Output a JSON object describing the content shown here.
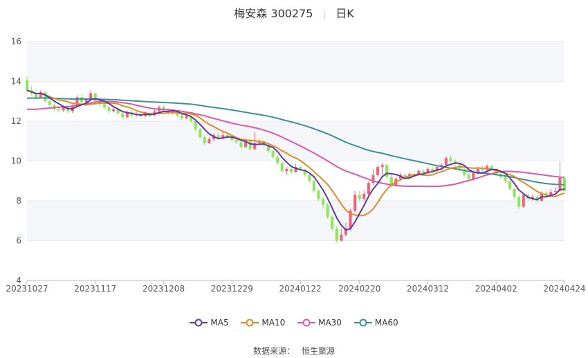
{
  "title": {
    "name": "梅安森 300275",
    "period": "日K"
  },
  "source": {
    "label": "数据来源：",
    "name": "恒生聚源"
  },
  "colors": {
    "up": "#f0637a",
    "down": "#8fe65a",
    "MA5": "#5d3a9b",
    "MA10": "#e08a2a",
    "MA30": "#d95aa8",
    "MA60": "#3a9196",
    "grid": "#e6e9f0",
    "band": "#f5f6fa"
  },
  "chart_data": {
    "type": "candlestick",
    "ylim": [
      4,
      16
    ],
    "yticks": [
      4,
      6,
      8,
      10,
      12,
      14,
      16
    ],
    "xticks": [
      "20231027",
      "20231117",
      "20231208",
      "20231229",
      "20240122",
      "20240220",
      "20240312",
      "20240402",
      "20240424"
    ],
    "xtick_index": [
      0,
      15,
      30,
      45,
      60,
      73,
      88,
      103,
      118
    ],
    "n": 119,
    "legend": [
      "MA5",
      "MA10",
      "MA30",
      "MA60"
    ],
    "ohlc": [
      [
        14.05,
        13.55,
        14.25,
        13.45
      ],
      [
        13.55,
        13.4,
        13.75,
        13.3
      ],
      [
        13.4,
        13.2,
        13.5,
        13.1
      ],
      [
        13.2,
        13.45,
        13.55,
        13.15
      ],
      [
        13.45,
        13.0,
        13.5,
        12.95
      ],
      [
        13.0,
        12.8,
        13.1,
        12.7
      ],
      [
        12.8,
        12.6,
        12.9,
        12.5
      ],
      [
        12.6,
        12.55,
        12.75,
        12.45
      ],
      [
        12.55,
        12.7,
        12.8,
        12.45
      ],
      [
        12.7,
        12.5,
        12.75,
        12.4
      ],
      [
        12.5,
        12.75,
        12.85,
        12.4
      ],
      [
        12.75,
        13.2,
        13.3,
        12.7
      ],
      [
        13.2,
        12.95,
        13.35,
        12.85
      ],
      [
        12.95,
        13.1,
        13.2,
        12.9
      ],
      [
        13.1,
        13.4,
        13.55,
        13.0
      ],
      [
        13.4,
        13.0,
        13.45,
        12.9
      ],
      [
        13.0,
        12.85,
        13.1,
        12.75
      ],
      [
        12.85,
        12.7,
        12.95,
        12.6
      ],
      [
        12.7,
        12.5,
        12.8,
        12.4
      ],
      [
        12.5,
        12.6,
        12.7,
        12.45
      ],
      [
        12.6,
        12.4,
        12.7,
        12.3
      ],
      [
        12.4,
        12.2,
        12.5,
        12.1
      ],
      [
        12.2,
        12.45,
        12.55,
        12.15
      ],
      [
        12.45,
        12.3,
        12.55,
        12.2
      ],
      [
        12.3,
        12.35,
        12.45,
        12.2
      ],
      [
        12.35,
        12.25,
        12.45,
        12.15
      ],
      [
        12.25,
        12.4,
        12.5,
        12.2
      ],
      [
        12.4,
        12.3,
        12.5,
        12.2
      ],
      [
        12.3,
        12.5,
        12.6,
        12.25
      ],
      [
        12.5,
        12.7,
        12.8,
        12.4
      ],
      [
        12.7,
        12.55,
        12.8,
        12.45
      ],
      [
        12.55,
        12.4,
        12.65,
        12.3
      ],
      [
        12.4,
        12.5,
        12.6,
        12.35
      ],
      [
        12.5,
        12.3,
        12.55,
        12.2
      ],
      [
        12.3,
        12.15,
        12.4,
        12.05
      ],
      [
        12.15,
        12.25,
        12.35,
        12.1
      ],
      [
        12.25,
        12.0,
        12.3,
        11.9
      ],
      [
        12.0,
        11.6,
        12.05,
        11.5
      ],
      [
        11.6,
        11.2,
        11.65,
        11.1
      ],
      [
        11.2,
        10.9,
        11.3,
        10.8
      ],
      [
        10.9,
        11.1,
        11.2,
        10.85
      ],
      [
        11.1,
        11.3,
        11.4,
        11.0
      ],
      [
        11.3,
        11.15,
        11.45,
        11.05
      ],
      [
        11.15,
        11.3,
        11.5,
        11.1
      ],
      [
        11.3,
        11.2,
        11.4,
        11.1
      ],
      [
        11.2,
        11.05,
        11.3,
        10.95
      ],
      [
        11.05,
        10.95,
        11.15,
        10.85
      ],
      [
        10.95,
        10.7,
        11.0,
        10.6
      ],
      [
        10.7,
        11.0,
        11.1,
        10.65
      ],
      [
        11.0,
        10.6,
        11.1,
        10.5
      ],
      [
        10.6,
        10.9,
        11.45,
        10.55
      ],
      [
        10.9,
        11.0,
        11.1,
        10.8
      ],
      [
        11.0,
        10.8,
        11.05,
        10.7
      ],
      [
        10.8,
        10.5,
        10.85,
        10.4
      ],
      [
        10.5,
        10.2,
        10.55,
        10.1
      ],
      [
        10.2,
        9.9,
        10.3,
        9.8
      ],
      [
        9.9,
        9.5,
        10.0,
        9.4
      ],
      [
        9.5,
        9.6,
        9.7,
        9.3
      ],
      [
        9.6,
        9.45,
        9.8,
        9.35
      ],
      [
        9.45,
        9.7,
        9.85,
        9.4
      ],
      [
        9.7,
        9.55,
        9.8,
        9.5
      ],
      [
        9.55,
        9.3,
        9.6,
        9.2
      ],
      [
        9.3,
        9.0,
        9.35,
        8.9
      ],
      [
        9.0,
        8.5,
        9.05,
        8.4
      ],
      [
        8.5,
        8.1,
        8.6,
        8.0
      ],
      [
        8.1,
        7.8,
        8.2,
        7.6
      ],
      [
        7.8,
        7.2,
        7.9,
        7.1
      ],
      [
        7.2,
        6.6,
        7.3,
        6.5
      ],
      [
        6.6,
        6.0,
        6.7,
        5.9
      ],
      [
        6.0,
        6.3,
        6.6,
        5.95
      ],
      [
        6.3,
        6.6,
        6.9,
        6.2
      ],
      [
        6.6,
        7.5,
        7.6,
        6.5
      ],
      [
        7.5,
        8.3,
        8.5,
        7.4
      ],
      [
        8.3,
        8.1,
        8.5,
        8.0
      ],
      [
        8.1,
        8.35,
        8.5,
        8.0
      ],
      [
        8.35,
        8.9,
        9.0,
        8.2
      ],
      [
        8.9,
        9.3,
        9.6,
        8.8
      ],
      [
        9.3,
        9.7,
        9.8,
        9.2
      ],
      [
        9.7,
        9.8,
        9.9,
        9.3
      ],
      [
        9.8,
        9.2,
        9.85,
        9.1
      ],
      [
        9.2,
        8.8,
        9.3,
        8.7
      ],
      [
        8.8,
        9.1,
        9.2,
        8.75
      ],
      [
        9.1,
        9.3,
        9.4,
        9.0
      ],
      [
        9.3,
        9.2,
        9.4,
        9.1
      ],
      [
        9.2,
        9.35,
        9.45,
        9.15
      ],
      [
        9.35,
        9.3,
        9.45,
        9.2
      ],
      [
        9.3,
        9.5,
        9.6,
        9.25
      ],
      [
        9.5,
        9.4,
        9.6,
        9.3
      ],
      [
        9.4,
        9.6,
        9.7,
        9.35
      ],
      [
        9.6,
        9.5,
        9.7,
        9.4
      ],
      [
        9.5,
        9.7,
        9.8,
        9.45
      ],
      [
        9.7,
        9.8,
        9.9,
        9.6
      ],
      [
        9.8,
        10.15,
        10.25,
        9.75
      ],
      [
        10.15,
        10.0,
        10.3,
        9.9
      ],
      [
        10.0,
        9.85,
        10.1,
        9.7
      ],
      [
        9.85,
        9.6,
        9.9,
        9.5
      ],
      [
        9.6,
        9.3,
        9.65,
        9.2
      ],
      [
        9.3,
        9.1,
        9.4,
        9.0
      ],
      [
        9.1,
        9.4,
        9.5,
        9.0
      ],
      [
        9.4,
        9.6,
        9.7,
        9.3
      ],
      [
        9.6,
        9.55,
        9.75,
        9.45
      ],
      [
        9.55,
        9.75,
        9.85,
        9.5
      ],
      [
        9.75,
        9.6,
        9.8,
        9.5
      ],
      [
        9.6,
        9.35,
        9.65,
        9.25
      ],
      [
        9.35,
        9.2,
        9.45,
        9.1
      ],
      [
        9.2,
        9.0,
        9.3,
        8.9
      ],
      [
        9.0,
        8.6,
        9.05,
        8.5
      ],
      [
        8.6,
        8.2,
        8.65,
        8.1
      ],
      [
        8.2,
        7.7,
        8.3,
        7.6
      ],
      [
        7.7,
        8.3,
        8.4,
        7.65
      ],
      [
        8.3,
        8.1,
        8.4,
        8.0
      ],
      [
        8.1,
        8.2,
        8.35,
        8.0
      ],
      [
        8.2,
        8.0,
        8.3,
        7.9
      ],
      [
        8.0,
        8.4,
        8.5,
        7.95
      ],
      [
        8.4,
        8.3,
        8.5,
        8.2
      ],
      [
        8.3,
        8.45,
        8.6,
        8.2
      ],
      [
        8.45,
        8.5,
        8.7,
        8.4
      ],
      [
        8.5,
        9.15,
        9.95,
        8.45
      ],
      [
        9.15,
        8.5,
        9.2,
        8.45
      ]
    ],
    "ma30": [
      12.6,
      12.6,
      12.6,
      12.62,
      12.64,
      12.66,
      12.68,
      12.7,
      12.72,
      12.74,
      12.76,
      12.8,
      12.84,
      12.88,
      12.92,
      12.96,
      12.98,
      12.99,
      12.99,
      12.98,
      12.96,
      12.93,
      12.9,
      12.86,
      12.8,
      12.75,
      12.7,
      12.66,
      12.62,
      12.6,
      12.59,
      12.58,
      12.56,
      12.53,
      12.5,
      12.46,
      12.42,
      12.37,
      12.32,
      12.27,
      12.2,
      12.14,
      12.08,
      12.02,
      11.96,
      11.9,
      11.85,
      11.8,
      11.76,
      11.72,
      11.67,
      11.62,
      11.55,
      11.48,
      11.4,
      11.3,
      11.2,
      11.09,
      10.98,
      10.87,
      10.76,
      10.64,
      10.52,
      10.4,
      10.27,
      10.14,
      10.0,
      9.86,
      9.72,
      9.6,
      9.5,
      9.42,
      9.34,
      9.25,
      9.16,
      9.08,
      9.0,
      8.94,
      8.88,
      8.84,
      8.8,
      8.77,
      8.75,
      8.74,
      8.73,
      8.73,
      8.73,
      8.73,
      8.72,
      8.72,
      8.72,
      8.74,
      8.77,
      8.8,
      8.84,
      8.9,
      8.96,
      9.02,
      9.08,
      9.15,
      9.23,
      9.3,
      9.36,
      9.42,
      9.46,
      9.48,
      9.48,
      9.47,
      9.45,
      9.43,
      9.4,
      9.37,
      9.34,
      9.31,
      9.28,
      9.25,
      9.22,
      9.19,
      9.18
    ]
  }
}
